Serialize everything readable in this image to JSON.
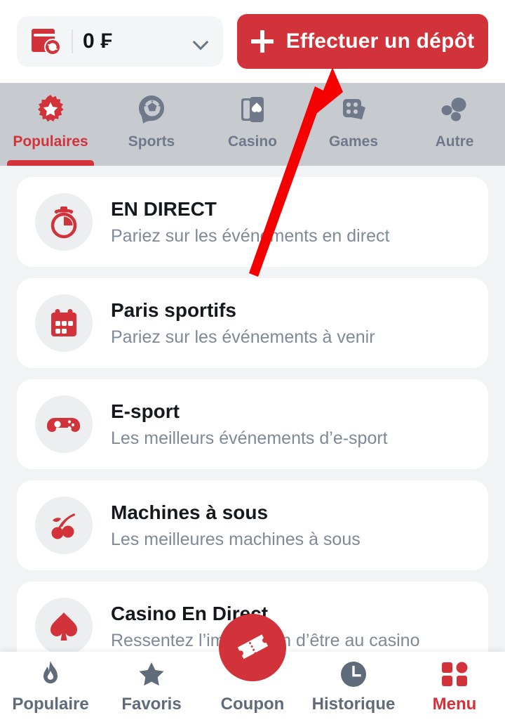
{
  "topbar": {
    "wallet_icon": "wallet-refresh-icon",
    "balance": "0 ₣",
    "dropdown_icon": "chevron-down-icon",
    "deposit_button": "Effectuer un dépôt",
    "deposit_plus_icon": "plus-icon"
  },
  "category_tabs": {
    "active_index": 0,
    "items": [
      {
        "label": "Populaires",
        "icon": "starburst-badge-icon",
        "active": true
      },
      {
        "label": "Sports",
        "icon": "soccer-ball-icon",
        "active": false
      },
      {
        "label": "Casino",
        "icon": "playing-cards-icon",
        "active": false
      },
      {
        "label": "Games",
        "icon": "dice-icon",
        "active": false
      },
      {
        "label": "Autre",
        "icon": "three-circles-icon",
        "active": false
      }
    ]
  },
  "list": {
    "items": [
      {
        "title": "EN DIRECT",
        "subtitle": "Pariez sur les événements en direct",
        "icon": "stopwatch-icon"
      },
      {
        "title": "Paris sportifs",
        "subtitle": "Pariez sur les événements à venir",
        "icon": "calendar-icon"
      },
      {
        "title": "E-sport",
        "subtitle": "Les meilleurs événements d’e-sport",
        "icon": "gamepad-icon"
      },
      {
        "title": "Machines à sous",
        "subtitle": "Les meilleures machines à sous",
        "icon": "cherries-icon"
      },
      {
        "title": "Casino En Direct",
        "subtitle": "Ressentez l’impression d’être au casino",
        "icon": "spade-icon"
      }
    ]
  },
  "bottom_nav": {
    "active_index": 4,
    "items": [
      {
        "label": "Populaire",
        "icon": "flame-icon",
        "active": false
      },
      {
        "label": "Favoris",
        "icon": "star-icon",
        "active": false
      },
      {
        "label": "Coupon",
        "icon": "ticket-icon",
        "active": false
      },
      {
        "label": "Historique",
        "icon": "clock-icon",
        "active": false
      },
      {
        "label": "Menu",
        "icon": "grid-icon",
        "active": true
      }
    ]
  },
  "fab": {
    "icon": "ticket-icon"
  },
  "annotation": {
    "icon": "red-arrow-annotation"
  },
  "colors": {
    "brand_red": "#d2333a",
    "tabbar_gray": "#c7cbd0",
    "page_bg": "#f1f3f4",
    "card_bg": "#ffffff",
    "title_text": "#15181c",
    "subtitle_text": "#7f8a97",
    "nav_text": "#5f6b78",
    "annotation_red": "#f50000"
  }
}
